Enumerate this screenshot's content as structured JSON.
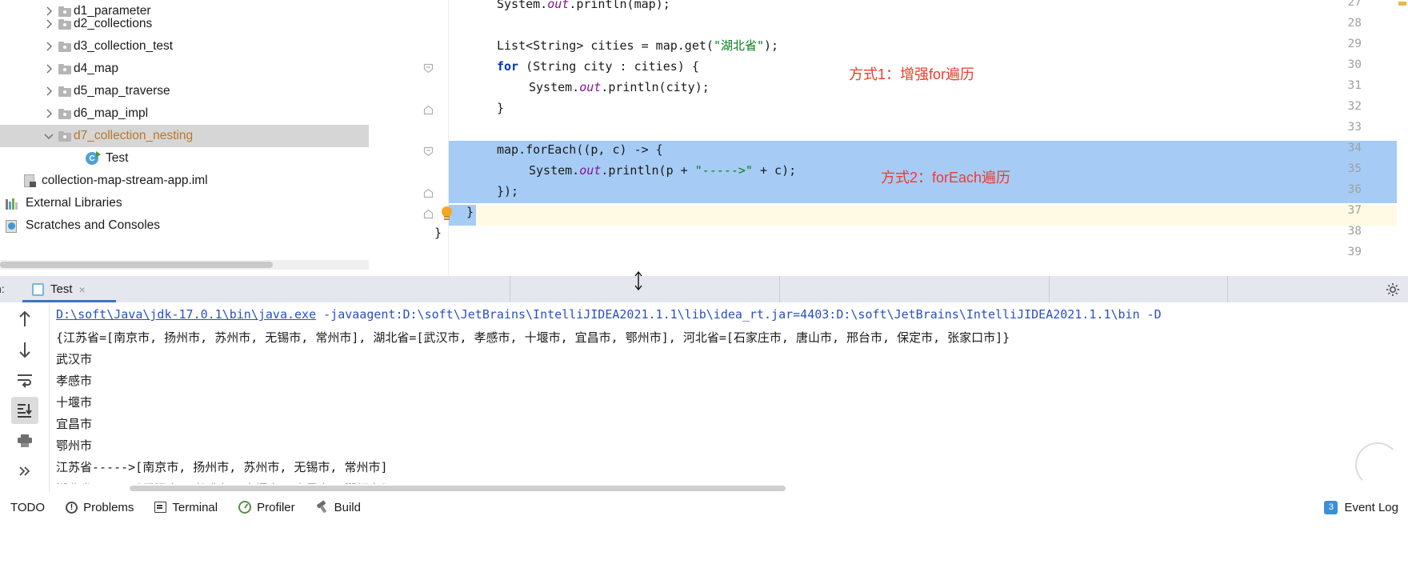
{
  "project_tree": {
    "items": [
      {
        "label": "d1_parameter",
        "icon": "folder-icon",
        "arrow": "chevron-right-icon",
        "indent": 52,
        "selected": false,
        "partial": true
      },
      {
        "label": "d2_collections",
        "icon": "folder-icon",
        "arrow": "chevron-right-icon",
        "indent": 52,
        "selected": false
      },
      {
        "label": "d3_collection_test",
        "icon": "folder-icon",
        "arrow": "chevron-right-icon",
        "indent": 52,
        "selected": false
      },
      {
        "label": "d4_map",
        "icon": "folder-icon",
        "arrow": "chevron-right-icon",
        "indent": 52,
        "selected": false
      },
      {
        "label": "d5_map_traverse",
        "icon": "folder-icon",
        "arrow": "chevron-right-icon",
        "indent": 52,
        "selected": false
      },
      {
        "label": "d6_map_impl",
        "icon": "folder-icon",
        "arrow": "chevron-right-icon",
        "indent": 52,
        "selected": false
      },
      {
        "label": "d7_collection_nesting",
        "icon": "folder-icon",
        "arrow": "chevron-down-icon",
        "indent": 52,
        "selected": true
      },
      {
        "label": "Test",
        "icon": "java-class-icon",
        "arrow": "",
        "indent": 100,
        "selected": false
      },
      {
        "label": "collection-map-stream-app.iml",
        "icon": "iml-file-icon",
        "arrow": "",
        "indent": 26,
        "selected": false
      },
      {
        "label": "External Libraries",
        "icon": "external-libraries-icon",
        "arrow": "",
        "indent": 4,
        "selected": false
      },
      {
        "label": "Scratches and Consoles",
        "icon": "scratches-icon",
        "arrow": "",
        "indent": 4,
        "selected": false
      }
    ]
  },
  "editor": {
    "line_numbers": [
      "27",
      "28",
      "29",
      "30",
      "31",
      "32",
      "33",
      "34",
      "35",
      "36",
      "37",
      "38",
      "39"
    ],
    "lines": [
      {
        "n": "27",
        "text": "System.out.println(map);"
      },
      {
        "n": "28",
        "text": ""
      },
      {
        "n": "29",
        "text": "List<String> cities = map.get(\"湖北省\");"
      },
      {
        "n": "30",
        "text": "for (String city : cities) {"
      },
      {
        "n": "31",
        "text": "System.out.println(city);"
      },
      {
        "n": "32",
        "text": "}"
      },
      {
        "n": "33",
        "text": ""
      },
      {
        "n": "34",
        "text": "map.forEach((p, c) -> {"
      },
      {
        "n": "35",
        "text": "System.out.println(p + \"----->\" + c);"
      },
      {
        "n": "36",
        "text": "});"
      },
      {
        "n": "37",
        "text": "}"
      },
      {
        "n": "38",
        "text": "}"
      },
      {
        "n": "39",
        "text": ""
      }
    ],
    "tokens": {
      "sys": "System.",
      "out": "out",
      "println_map": ".println(map);",
      "list_decl_a": "List<String> cities = map.get(",
      "list_decl_str": "\"湖北省\"",
      "list_decl_b": ");",
      "kw_for": "for",
      "for_rest": " (String city : cities) {",
      "println_city": ".println(city);",
      "brace_close": "}",
      "foreach": "map.forEach((p, c) -> {",
      "println_pc_a": ".println(p + ",
      "println_pc_str": "\"----->\"",
      "println_pc_b": " + c);",
      "foreach_close": "});"
    },
    "annotations": [
      {
        "text": "方式1：增强for遍历",
        "color": "#ef3b2c"
      },
      {
        "text": "方式2：forEach遍历",
        "color": "#ef3b2c"
      }
    ]
  },
  "run_panel": {
    "label": "n:",
    "tab_name": "Test",
    "close_icon": "×",
    "gear_icon": "gear-icon",
    "side_tools": [
      {
        "name": "rerun-up-icon",
        "glyph": "↑",
        "active": false
      },
      {
        "name": "rerun-down-icon",
        "glyph": "↓",
        "active": false
      },
      {
        "name": "soft-wrap-icon",
        "glyph": "⇥",
        "active": false
      },
      {
        "name": "scroll-to-end-icon",
        "glyph": "⇊",
        "active": true
      },
      {
        "name": "print-icon",
        "glyph": "🖶",
        "active": false
      },
      {
        "name": "more-icon",
        "glyph": "»",
        "active": false
      }
    ],
    "output": [
      {
        "type": "command",
        "link": "D:\\soft\\Java\\jdk-17.0.1\\bin\\java.exe",
        "rest": " -javaagent:D:\\soft\\JetBrains\\IntelliJIDEA2021.1.1\\lib\\idea_rt.jar=4403:D:\\soft\\JetBrains\\IntelliJIDEA2021.1.1\\bin  -D"
      },
      {
        "type": "text",
        "text": "{江苏省=[南京市, 扬州市, 苏州市, 无锡市, 常州市], 湖北省=[武汉市, 孝感市, 十堰市, 宜昌市, 鄂州市], 河北省=[石家庄市, 唐山市, 邢台市, 保定市, 张家口市]}"
      },
      {
        "type": "text",
        "text": "武汉市"
      },
      {
        "type": "text",
        "text": "孝感市"
      },
      {
        "type": "text",
        "text": "十堰市"
      },
      {
        "type": "text",
        "text": "宜昌市"
      },
      {
        "type": "text",
        "text": "鄂州市"
      },
      {
        "type": "text",
        "text": "江苏省----->[南京市, 扬州市, 苏州市, 无锡市, 常州市]"
      },
      {
        "type": "text",
        "text": "湖北省----->[武汉市, 孝感市, 十堰市, 宜昌市, 鄂州市]",
        "faded": true
      }
    ]
  },
  "status_bar": {
    "items": [
      {
        "label": "TODO",
        "icon": ""
      },
      {
        "label": "Problems",
        "icon": "problems-icon"
      },
      {
        "label": "Terminal",
        "icon": "terminal-icon"
      },
      {
        "label": "Profiler",
        "icon": "profiler-icon"
      },
      {
        "label": "Build",
        "icon": "build-icon"
      }
    ],
    "event_log": {
      "count": "3",
      "label": "Event Log"
    }
  },
  "colors": {
    "keyword": "#0033b3",
    "string": "#067d17",
    "field": "#871094",
    "selection": "#a6ccf5",
    "caret_line": "#fffae3",
    "annotation": "#ef3b2c",
    "link": "#2b4ec4",
    "accent": "#3b74c4"
  }
}
